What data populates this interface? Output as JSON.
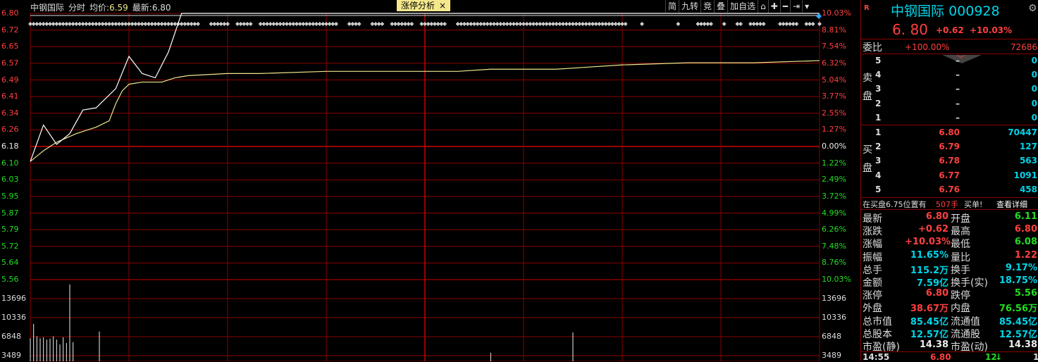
{
  "header": {
    "stock_name": "中钢国际",
    "mode": "分时",
    "avg_label": "均价:",
    "avg_value": "6.59",
    "latest_label": "最新:",
    "latest_value": "6.80",
    "tab_label": "涨停分析",
    "tab_close": "×"
  },
  "toolbar": [
    "简",
    "九转",
    "竞",
    "叠",
    "加自选",
    "⌂",
    "✚",
    "━",
    "⇥",
    "▾"
  ],
  "price_axis": {
    "left": [
      {
        "v": "6.80",
        "c": "up"
      },
      {
        "v": "6.72",
        "c": "up"
      },
      {
        "v": "6.65",
        "c": "up"
      },
      {
        "v": "6.57",
        "c": "up"
      },
      {
        "v": "6.49",
        "c": "up"
      },
      {
        "v": "6.41",
        "c": "up"
      },
      {
        "v": "6.34",
        "c": "up"
      },
      {
        "v": "6.26",
        "c": "up"
      },
      {
        "v": "6.18",
        "c": "wt"
      },
      {
        "v": "6.10",
        "c": "dn"
      },
      {
        "v": "6.03",
        "c": "dn"
      },
      {
        "v": "5.95",
        "c": "dn"
      },
      {
        "v": "5.87",
        "c": "dn"
      },
      {
        "v": "5.79",
        "c": "dn"
      },
      {
        "v": "5.72",
        "c": "dn"
      },
      {
        "v": "5.64",
        "c": "dn"
      },
      {
        "v": "5.56",
        "c": "dn"
      }
    ],
    "right": [
      {
        "v": "10.03%",
        "c": "up"
      },
      {
        "v": "8.81%",
        "c": "up"
      },
      {
        "v": "7.54%",
        "c": "up"
      },
      {
        "v": "6.32%",
        "c": "up"
      },
      {
        "v": "5.04%",
        "c": "up"
      },
      {
        "v": "3.77%",
        "c": "up"
      },
      {
        "v": "2.55%",
        "c": "up"
      },
      {
        "v": "1.27%",
        "c": "up"
      },
      {
        "v": "0.00%",
        "c": "wt"
      },
      {
        "v": "1.22%",
        "c": "dn"
      },
      {
        "v": "2.49%",
        "c": "dn"
      },
      {
        "v": "3.72%",
        "c": "dn"
      },
      {
        "v": "4.99%",
        "c": "dn"
      },
      {
        "v": "6.26%",
        "c": "dn"
      },
      {
        "v": "7.48%",
        "c": "dn"
      },
      {
        "v": "8.76%",
        "c": "dn"
      },
      {
        "v": "10.03%",
        "c": "dn"
      }
    ]
  },
  "volume_axis": {
    "labels": [
      "13696",
      "10336",
      "6848",
      "3489"
    ]
  },
  "chart_data": {
    "type": "line",
    "y_range": [
      5.56,
      6.8
    ],
    "prev_close": 6.18,
    "volume_range": [
      0,
      17000
    ],
    "price": [
      [
        0,
        6.11
      ],
      [
        4,
        6.28
      ],
      [
        8,
        6.19
      ],
      [
        12,
        6.24
      ],
      [
        16,
        6.35
      ],
      [
        20,
        6.36
      ],
      [
        26,
        6.45
      ],
      [
        30,
        6.6
      ],
      [
        34,
        6.52
      ],
      [
        38,
        6.5
      ],
      [
        42,
        6.62
      ],
      [
        46,
        6.8
      ],
      [
        50,
        6.8
      ],
      [
        240,
        6.8
      ]
    ],
    "avg_price": [
      [
        0,
        6.11
      ],
      [
        4,
        6.16
      ],
      [
        8,
        6.2
      ],
      [
        14,
        6.24
      ],
      [
        20,
        6.27
      ],
      [
        24,
        6.3
      ],
      [
        26,
        6.38
      ],
      [
        28,
        6.44
      ],
      [
        30,
        6.47
      ],
      [
        34,
        6.48
      ],
      [
        40,
        6.48
      ],
      [
        44,
        6.5
      ],
      [
        48,
        6.51
      ],
      [
        60,
        6.52
      ],
      [
        70,
        6.52
      ],
      [
        90,
        6.53
      ],
      [
        110,
        6.53
      ],
      [
        130,
        6.53
      ],
      [
        140,
        6.54
      ],
      [
        150,
        6.54
      ],
      [
        160,
        6.54
      ],
      [
        170,
        6.55
      ],
      [
        180,
        6.56
      ],
      [
        200,
        6.57
      ],
      [
        220,
        6.57
      ],
      [
        240,
        6.58
      ]
    ],
    "volume": [
      [
        0,
        4800
      ],
      [
        1,
        7800
      ],
      [
        2,
        5200
      ],
      [
        3,
        4800
      ],
      [
        4,
        5000
      ],
      [
        5,
        4500
      ],
      [
        6,
        4700
      ],
      [
        7,
        5200
      ],
      [
        8,
        4500
      ],
      [
        9,
        3500
      ],
      [
        10,
        5000
      ],
      [
        11,
        3800
      ],
      [
        12,
        16000
      ],
      [
        13,
        4000
      ],
      [
        21,
        6200
      ],
      [
        140,
        1800
      ],
      [
        165,
        6000
      ]
    ],
    "markers_x": [
      0,
      1,
      2,
      3,
      4,
      5,
      6,
      7,
      8,
      9,
      10,
      11,
      12,
      13,
      14,
      15,
      16,
      17,
      18,
      19,
      20,
      21,
      22,
      23,
      24,
      25,
      26,
      27,
      28,
      29,
      30,
      31,
      32,
      33,
      34,
      35,
      36,
      37,
      38,
      39,
      40,
      41,
      42,
      43,
      44,
      45,
      46,
      47,
      48,
      49,
      50,
      51,
      55,
      56,
      57,
      58,
      59,
      60,
      63,
      64,
      65,
      66,
      67,
      70,
      71,
      72,
      73,
      74,
      75,
      76,
      77,
      78,
      79,
      80,
      81,
      82,
      83,
      84,
      85,
      86,
      87,
      88,
      89,
      90,
      91,
      92,
      93,
      97,
      98,
      99,
      100,
      104,
      105,
      106,
      107,
      110,
      111,
      112,
      113,
      114,
      115,
      116,
      119,
      120,
      121,
      122,
      123,
      124,
      125,
      126,
      130,
      131,
      132,
      133,
      134,
      135,
      136,
      137,
      138,
      139,
      140,
      141,
      142,
      143,
      144,
      145,
      146,
      147,
      148,
      149,
      150,
      151,
      152,
      153,
      154,
      155,
      156,
      157,
      158,
      159,
      160,
      161,
      162,
      163,
      164,
      165,
      166,
      167,
      168,
      169,
      170,
      171,
      172,
      173,
      174,
      175,
      176,
      177,
      178,
      179,
      180,
      181,
      186,
      197,
      203,
      204,
      205,
      206,
      207,
      211,
      215,
      216,
      219,
      220,
      221,
      222,
      223,
      228,
      229,
      230,
      231,
      232,
      233,
      236,
      237,
      238,
      240
    ]
  },
  "panel": {
    "r_badge": "R",
    "name": "中钢国际",
    "code": "000928",
    "price": "6. 80",
    "change": "+0.62",
    "change_pct": "+10.03%",
    "webi_label": "委比",
    "webi_pct": "+100.00%",
    "webi_diff": "72686",
    "sell_label": "卖盘",
    "buy_label": "买盘",
    "sell": [
      {
        "n": "5",
        "p": "–",
        "q": "0"
      },
      {
        "n": "4",
        "p": "–",
        "q": "0"
      },
      {
        "n": "3",
        "p": "–",
        "q": "0"
      },
      {
        "n": "2",
        "p": "–",
        "q": "0"
      },
      {
        "n": "1",
        "p": "–",
        "q": "0"
      }
    ],
    "buy": [
      {
        "n": "1",
        "p": "6.80",
        "q": "70447"
      },
      {
        "n": "2",
        "p": "6.79",
        "q": "127"
      },
      {
        "n": "3",
        "p": "6.78",
        "q": "563"
      },
      {
        "n": "4",
        "p": "6.77",
        "q": "1091"
      },
      {
        "n": "5",
        "p": "6.76",
        "q": "458"
      }
    ],
    "notice_a": "在买盘6.75位置有",
    "notice_b": "507手",
    "notice_c": "买单!",
    "notice_d": "查看详细",
    "stats": [
      {
        "l1": "最新",
        "v1": "6.80",
        "c1": "up",
        "l2": "开盘",
        "v2": "6.11",
        "c2": "dn"
      },
      {
        "l1": "涨跌",
        "v1": "+0.62",
        "c1": "up",
        "l2": "最高",
        "v2": "6.80",
        "c2": "up"
      },
      {
        "l1": "涨幅",
        "v1": "+10.03%",
        "c1": "up",
        "l2": "最低",
        "v2": "6.08",
        "c2": "dn"
      },
      {
        "l1": "振幅",
        "v1": "11.65%",
        "c1": "cy",
        "l2": "量比",
        "v2": "1.22",
        "c2": "up"
      },
      {
        "l1": "总手",
        "v1": "115.2万",
        "c1": "cy",
        "l2": "换手",
        "v2": "9.17%",
        "c2": "cy"
      },
      {
        "l1": "金额",
        "v1": "7.59亿",
        "c1": "cy",
        "l2": "换手(实)",
        "v2": "18.75%",
        "c2": "cy"
      },
      {
        "l1": "涨停",
        "v1": "6.80",
        "c1": "up",
        "l2": "跌停",
        "v2": "5.56",
        "c2": "dn"
      },
      {
        "l1": "外盘",
        "v1": "38.67万",
        "c1": "up",
        "l2": "内盘",
        "v2": "76.56万",
        "c2": "dn"
      },
      {
        "l1": "总市值",
        "v1": "85.45亿",
        "c1": "cy",
        "l2": "流通值",
        "v2": "85.45亿",
        "c2": "cy"
      },
      {
        "l1": "总股本",
        "v1": "12.57亿",
        "c1": "cy",
        "l2": "流通股",
        "v2": "12.57亿",
        "c2": "cy"
      },
      {
        "l1": "市盈(静)",
        "v1": "14.38",
        "c1": "wt",
        "l2": "市盈(动)",
        "v2": "14.38",
        "c2": "wt"
      }
    ],
    "last_trade": {
      "time": "14:55",
      "price": "6.80",
      "vol": "12",
      "dir": "↓",
      "n": "1"
    }
  },
  "colors": {
    "up": "#ff4040",
    "down": "#22dd22",
    "price_line": "#ffffff",
    "avg_line": "#f0e68c",
    "grid": "#8b0000"
  }
}
